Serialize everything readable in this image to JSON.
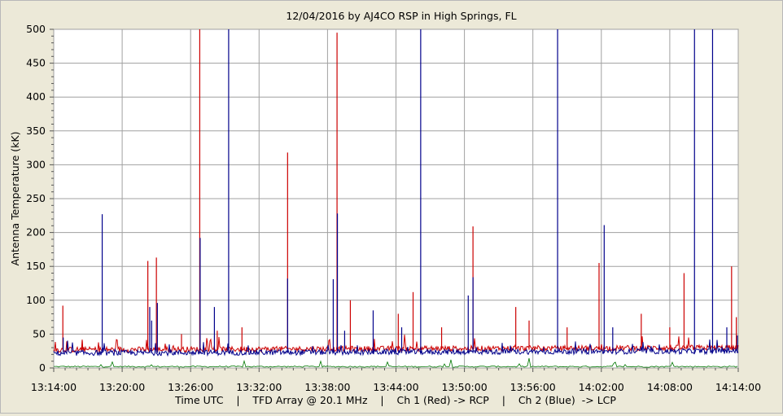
{
  "chart_data": {
    "type": "line",
    "title": "12/04/2016   by   AJ4CO RSP   in   High Springs, FL",
    "xlabel": "Time UTC    |    TFD Array @ 20.1 MHz    |    Ch 1 (Red) -> RCP    |    Ch 2 (Blue)  -> LCP",
    "ylabel": "Antenna Temperature (kK)",
    "ylim": [
      0,
      500
    ],
    "yticks": [
      0,
      50,
      100,
      150,
      200,
      250,
      300,
      350,
      400,
      450,
      500
    ],
    "xlim": [
      "13:14:00",
      "14:14:00"
    ],
    "xticks": [
      "13:14:00",
      "13:20:00",
      "13:26:00",
      "13:32:00",
      "13:38:00",
      "13:44:00",
      "13:50:00",
      "13:56:00",
      "14:02:00",
      "14:08:00",
      "14:14:00"
    ],
    "grid": true,
    "colors": {
      "red": "#cc0000",
      "blue": "#00008b",
      "green": "#007700",
      "plot_bg": "#ffffff",
      "grid": "#a0a0a0"
    },
    "series": [
      {
        "color": "red",
        "baseline": 27,
        "spikes": [
          {
            "t": "13:14:48",
            "v": 92
          },
          {
            "t": "13:16:30",
            "v": 40
          },
          {
            "t": "13:22:15",
            "v": 158
          },
          {
            "t": "13:23:00",
            "v": 163
          },
          {
            "t": "13:25:12",
            "v": 50
          },
          {
            "t": "13:26:48",
            "v": 500
          },
          {
            "t": "13:28:20",
            "v": 55
          },
          {
            "t": "13:30:30",
            "v": 60
          },
          {
            "t": "13:34:30",
            "v": 318
          },
          {
            "t": "13:38:50",
            "v": 495
          },
          {
            "t": "13:40:00",
            "v": 100
          },
          {
            "t": "13:44:12",
            "v": 80
          },
          {
            "t": "13:45:30",
            "v": 112
          },
          {
            "t": "13:48:00",
            "v": 60
          },
          {
            "t": "13:50:45",
            "v": 209
          },
          {
            "t": "13:54:30",
            "v": 90
          },
          {
            "t": "13:55:40",
            "v": 70
          },
          {
            "t": "13:59:00",
            "v": 60
          },
          {
            "t": "14:01:48",
            "v": 155
          },
          {
            "t": "14:05:30",
            "v": 80
          },
          {
            "t": "14:08:00",
            "v": 60
          },
          {
            "t": "14:09:15",
            "v": 140
          },
          {
            "t": "14:13:25",
            "v": 150
          },
          {
            "t": "14:13:50",
            "v": 75
          }
        ]
      },
      {
        "color": "blue",
        "baseline": 22,
        "spikes": [
          {
            "t": "13:14:50",
            "v": 45
          },
          {
            "t": "13:18:15",
            "v": 227
          },
          {
            "t": "13:22:25",
            "v": 90
          },
          {
            "t": "13:22:35",
            "v": 70
          },
          {
            "t": "13:23:05",
            "v": 96
          },
          {
            "t": "13:26:50",
            "v": 192
          },
          {
            "t": "13:28:05",
            "v": 90
          },
          {
            "t": "13:29:20",
            "v": 500
          },
          {
            "t": "13:34:30",
            "v": 132
          },
          {
            "t": "13:38:30",
            "v": 131
          },
          {
            "t": "13:38:52",
            "v": 228
          },
          {
            "t": "13:39:30",
            "v": 55
          },
          {
            "t": "13:42:00",
            "v": 85
          },
          {
            "t": "13:44:30",
            "v": 60
          },
          {
            "t": "13:46:10",
            "v": 500
          },
          {
            "t": "13:50:20",
            "v": 107
          },
          {
            "t": "13:50:45",
            "v": 134
          },
          {
            "t": "13:58:10",
            "v": 500
          },
          {
            "t": "14:02:15",
            "v": 211
          },
          {
            "t": "14:03:00",
            "v": 60
          },
          {
            "t": "14:10:10",
            "v": 500
          },
          {
            "t": "14:11:45",
            "v": 500
          },
          {
            "t": "14:13:00",
            "v": 60
          },
          {
            "t": "14:13:55",
            "v": 48
          }
        ]
      }
    ]
  }
}
